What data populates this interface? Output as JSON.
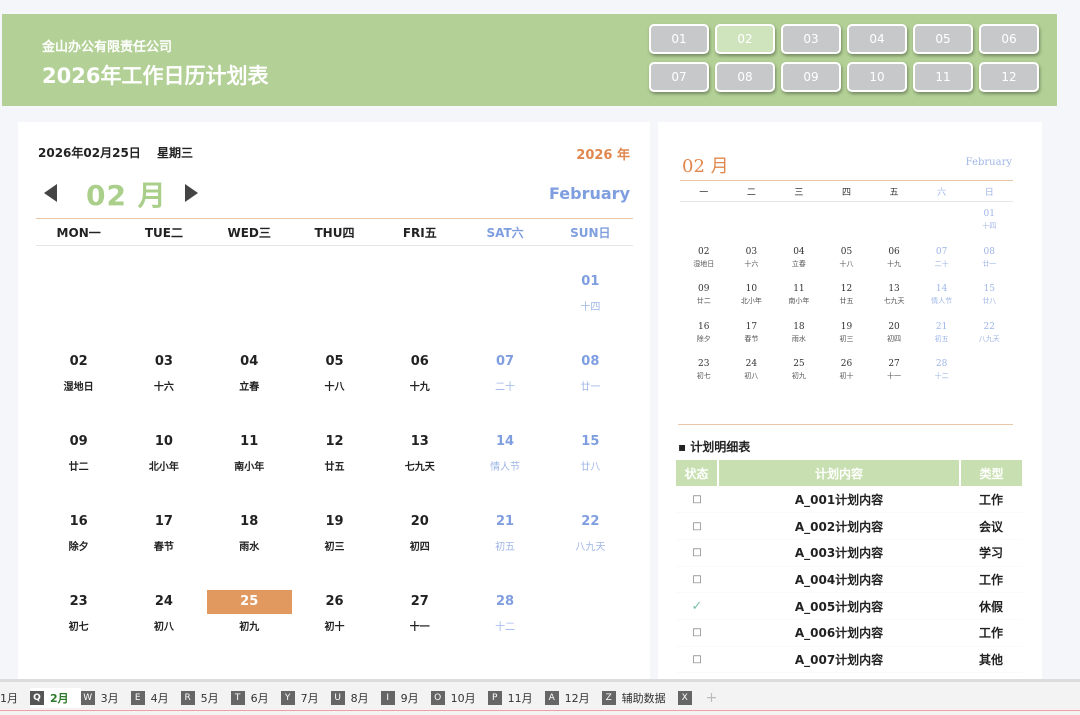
{
  "header": {
    "company": "金山办公有限责任公司",
    "title": "2026年工作日历计划表",
    "month_buttons": [
      "01",
      "02",
      "03",
      "04",
      "05",
      "06",
      "07",
      "08",
      "09",
      "10",
      "11",
      "12"
    ],
    "active_month": "02"
  },
  "left": {
    "date": "2026年02月25日",
    "weekday": "星期三",
    "year": "2026 年",
    "month": "02 月",
    "month_en": "February",
    "weekdays": [
      "MON一",
      "TUE二",
      "WED三",
      "THU四",
      "FRI五",
      "SAT六",
      "SUN日"
    ],
    "days": [
      {
        "d": "",
        "l": ""
      },
      {
        "d": "",
        "l": ""
      },
      {
        "d": "",
        "l": ""
      },
      {
        "d": "",
        "l": ""
      },
      {
        "d": "",
        "l": ""
      },
      {
        "d": "",
        "l": ""
      },
      {
        "d": "01",
        "l": "十四"
      },
      {
        "d": "02",
        "l": "湿地日"
      },
      {
        "d": "03",
        "l": "十六"
      },
      {
        "d": "04",
        "l": "立春"
      },
      {
        "d": "05",
        "l": "十八"
      },
      {
        "d": "06",
        "l": "十九"
      },
      {
        "d": "07",
        "l": "二十"
      },
      {
        "d": "08",
        "l": "廿一"
      },
      {
        "d": "09",
        "l": "廿二"
      },
      {
        "d": "10",
        "l": "北小年"
      },
      {
        "d": "11",
        "l": "南小年"
      },
      {
        "d": "12",
        "l": "廿五"
      },
      {
        "d": "13",
        "l": "七九天"
      },
      {
        "d": "14",
        "l": "情人节"
      },
      {
        "d": "15",
        "l": "廿八"
      },
      {
        "d": "16",
        "l": "除夕"
      },
      {
        "d": "17",
        "l": "春节"
      },
      {
        "d": "18",
        "l": "雨水"
      },
      {
        "d": "19",
        "l": "初三"
      },
      {
        "d": "20",
        "l": "初四"
      },
      {
        "d": "21",
        "l": "初五"
      },
      {
        "d": "22",
        "l": "八九天"
      },
      {
        "d": "23",
        "l": "初七"
      },
      {
        "d": "24",
        "l": "初八"
      },
      {
        "d": "25",
        "l": "初九"
      },
      {
        "d": "26",
        "l": "初十"
      },
      {
        "d": "27",
        "l": "十一"
      },
      {
        "d": "28",
        "l": "十二"
      },
      {
        "d": "",
        "l": ""
      }
    ],
    "today": "25"
  },
  "right": {
    "month": "02  月",
    "month_en": "February",
    "weekdays": [
      "一",
      "二",
      "三",
      "四",
      "五",
      "六",
      "日"
    ],
    "days": [
      {
        "d": "",
        "l": ""
      },
      {
        "d": "",
        "l": ""
      },
      {
        "d": "",
        "l": ""
      },
      {
        "d": "",
        "l": ""
      },
      {
        "d": "",
        "l": ""
      },
      {
        "d": "",
        "l": ""
      },
      {
        "d": "01",
        "l": "十四"
      },
      {
        "d": "02",
        "l": "湿地日"
      },
      {
        "d": "03",
        "l": "十六"
      },
      {
        "d": "04",
        "l": "立春"
      },
      {
        "d": "05",
        "l": "十八"
      },
      {
        "d": "06",
        "l": "十九"
      },
      {
        "d": "07",
        "l": "二十"
      },
      {
        "d": "08",
        "l": "廿一"
      },
      {
        "d": "09",
        "l": "廿二"
      },
      {
        "d": "10",
        "l": "北小年"
      },
      {
        "d": "11",
        "l": "南小年"
      },
      {
        "d": "12",
        "l": "廿五"
      },
      {
        "d": "13",
        "l": "七九天"
      },
      {
        "d": "14",
        "l": "情人节"
      },
      {
        "d": "15",
        "l": "廿八"
      },
      {
        "d": "16",
        "l": "除夕"
      },
      {
        "d": "17",
        "l": "春节"
      },
      {
        "d": "18",
        "l": "雨水"
      },
      {
        "d": "19",
        "l": "初三"
      },
      {
        "d": "20",
        "l": "初四"
      },
      {
        "d": "21",
        "l": "初五"
      },
      {
        "d": "22",
        "l": "八九天"
      },
      {
        "d": "23",
        "l": "初七"
      },
      {
        "d": "24",
        "l": "初八"
      },
      {
        "d": "25",
        "l": "初九"
      },
      {
        "d": "26",
        "l": "初十"
      },
      {
        "d": "27",
        "l": "十一"
      },
      {
        "d": "28",
        "l": "十二"
      },
      {
        "d": "",
        "l": ""
      }
    ],
    "plan_title": "▪ 计划明细表",
    "plan_headers": [
      "状态",
      "计划内容",
      "类型"
    ],
    "plan_rows": [
      {
        "status": "□",
        "done": false,
        "content": "A_001计划内容",
        "type": "工作"
      },
      {
        "status": "□",
        "done": false,
        "content": "A_002计划内容",
        "type": "会议"
      },
      {
        "status": "□",
        "done": false,
        "content": "A_003计划内容",
        "type": "学习"
      },
      {
        "status": "□",
        "done": false,
        "content": "A_004计划内容",
        "type": "工作"
      },
      {
        "status": "✓",
        "done": true,
        "content": "A_005计划内容",
        "type": "休假"
      },
      {
        "status": "□",
        "done": false,
        "content": "A_006计划内容",
        "type": "工作"
      },
      {
        "status": "□",
        "done": false,
        "content": "A_007计划内容",
        "type": "其他"
      }
    ]
  },
  "sheet_tabs": [
    {
      "key": "",
      "label": "1月"
    },
    {
      "key": "Q",
      "label": "2月",
      "active": true
    },
    {
      "key": "W",
      "label": "3月"
    },
    {
      "key": "E",
      "label": "4月"
    },
    {
      "key": "R",
      "label": "5月"
    },
    {
      "key": "T",
      "label": "6月"
    },
    {
      "key": "Y",
      "label": "7月"
    },
    {
      "key": "U",
      "label": "8月"
    },
    {
      "key": "I",
      "label": "9月"
    },
    {
      "key": "O",
      "label": "10月"
    },
    {
      "key": "P",
      "label": "11月"
    },
    {
      "key": "A",
      "label": "12月"
    },
    {
      "key": "Z",
      "label": "辅助数据"
    },
    {
      "key": "X",
      "label": ""
    }
  ],
  "colors": {
    "header_bg": "#b3d196",
    "accent_orange": "#e0884f",
    "weekend_blue": "#7f9ee0",
    "today_bg": "#e1995f",
    "table_header": "#c8e0b1"
  }
}
